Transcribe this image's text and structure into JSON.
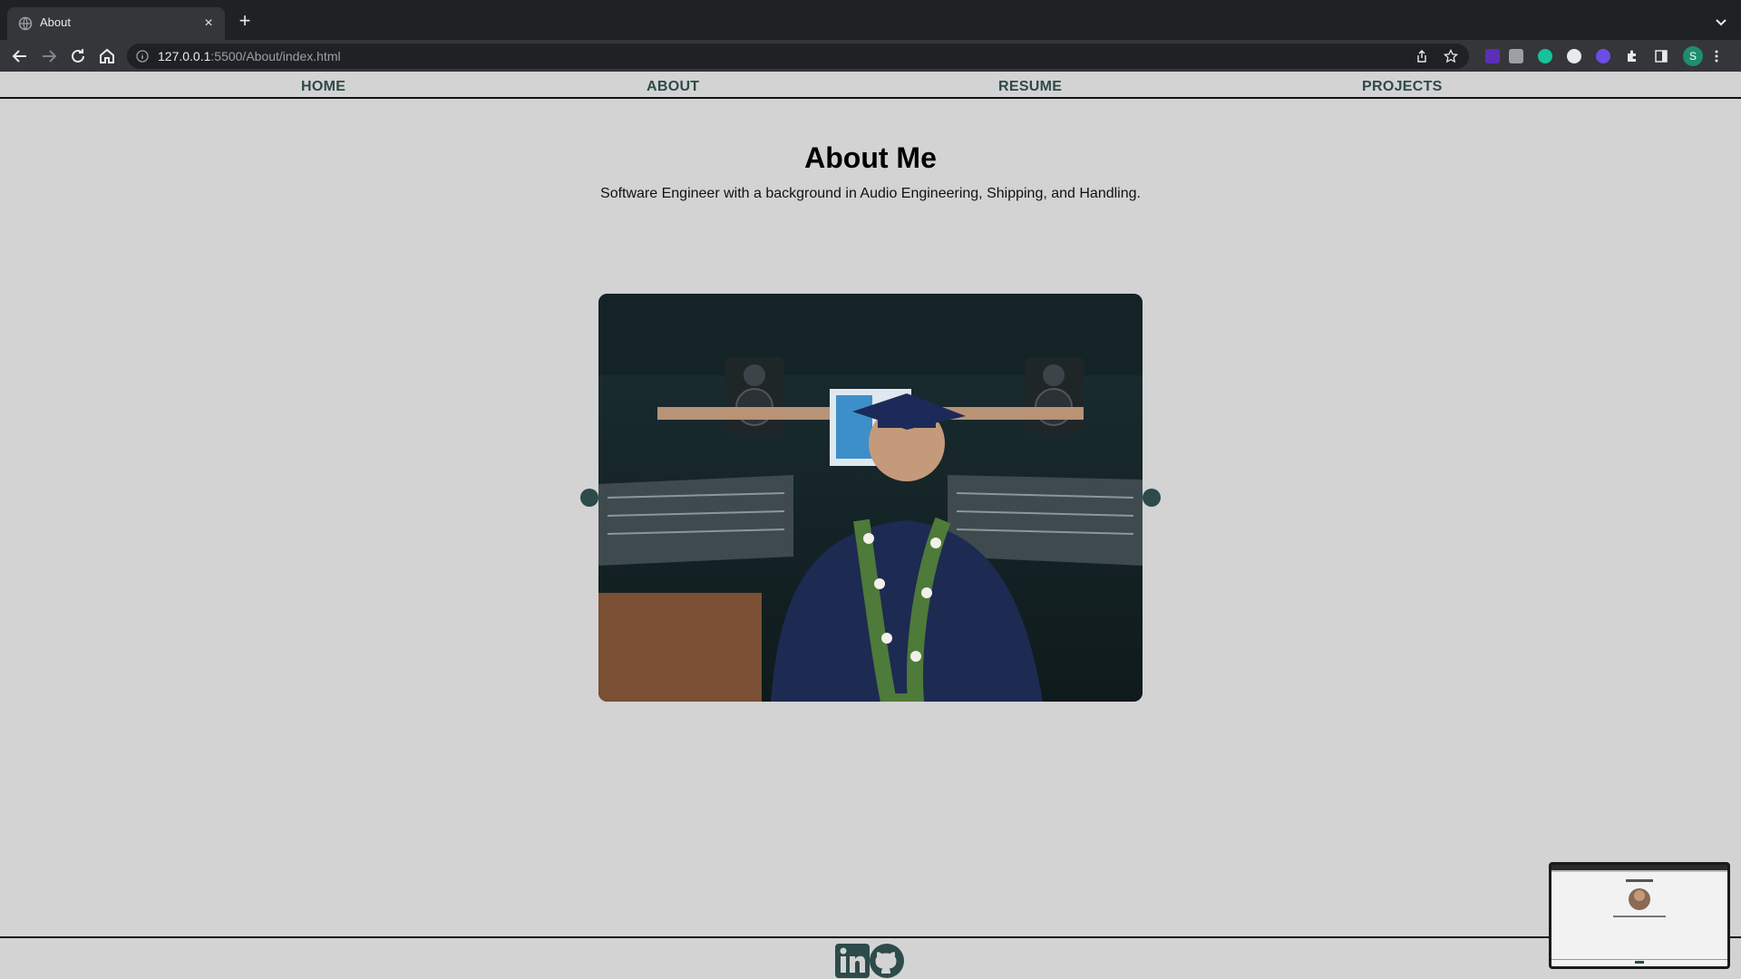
{
  "browser": {
    "tab_title": "About",
    "tab_close": "×",
    "new_tab": "+",
    "url_host": "127.0.0.1",
    "url_rest": ":5500/About/index.html",
    "profile_initial": "S"
  },
  "nav": {
    "home": "HOME",
    "about": "ABOUT",
    "resume": "RESUME",
    "projects": "PROJECTS"
  },
  "hero": {
    "title": "About Me",
    "subtitle": "Software Engineer with a background in Audio Engineering, Shipping, and Handling."
  },
  "footer": {
    "linkedin_icon": "linkedin-icon",
    "github_icon": "github-icon"
  },
  "colors": {
    "page_bg": "#d3d3d3",
    "nav_text": "#2e4a48",
    "accent": "#2d4b4a"
  }
}
